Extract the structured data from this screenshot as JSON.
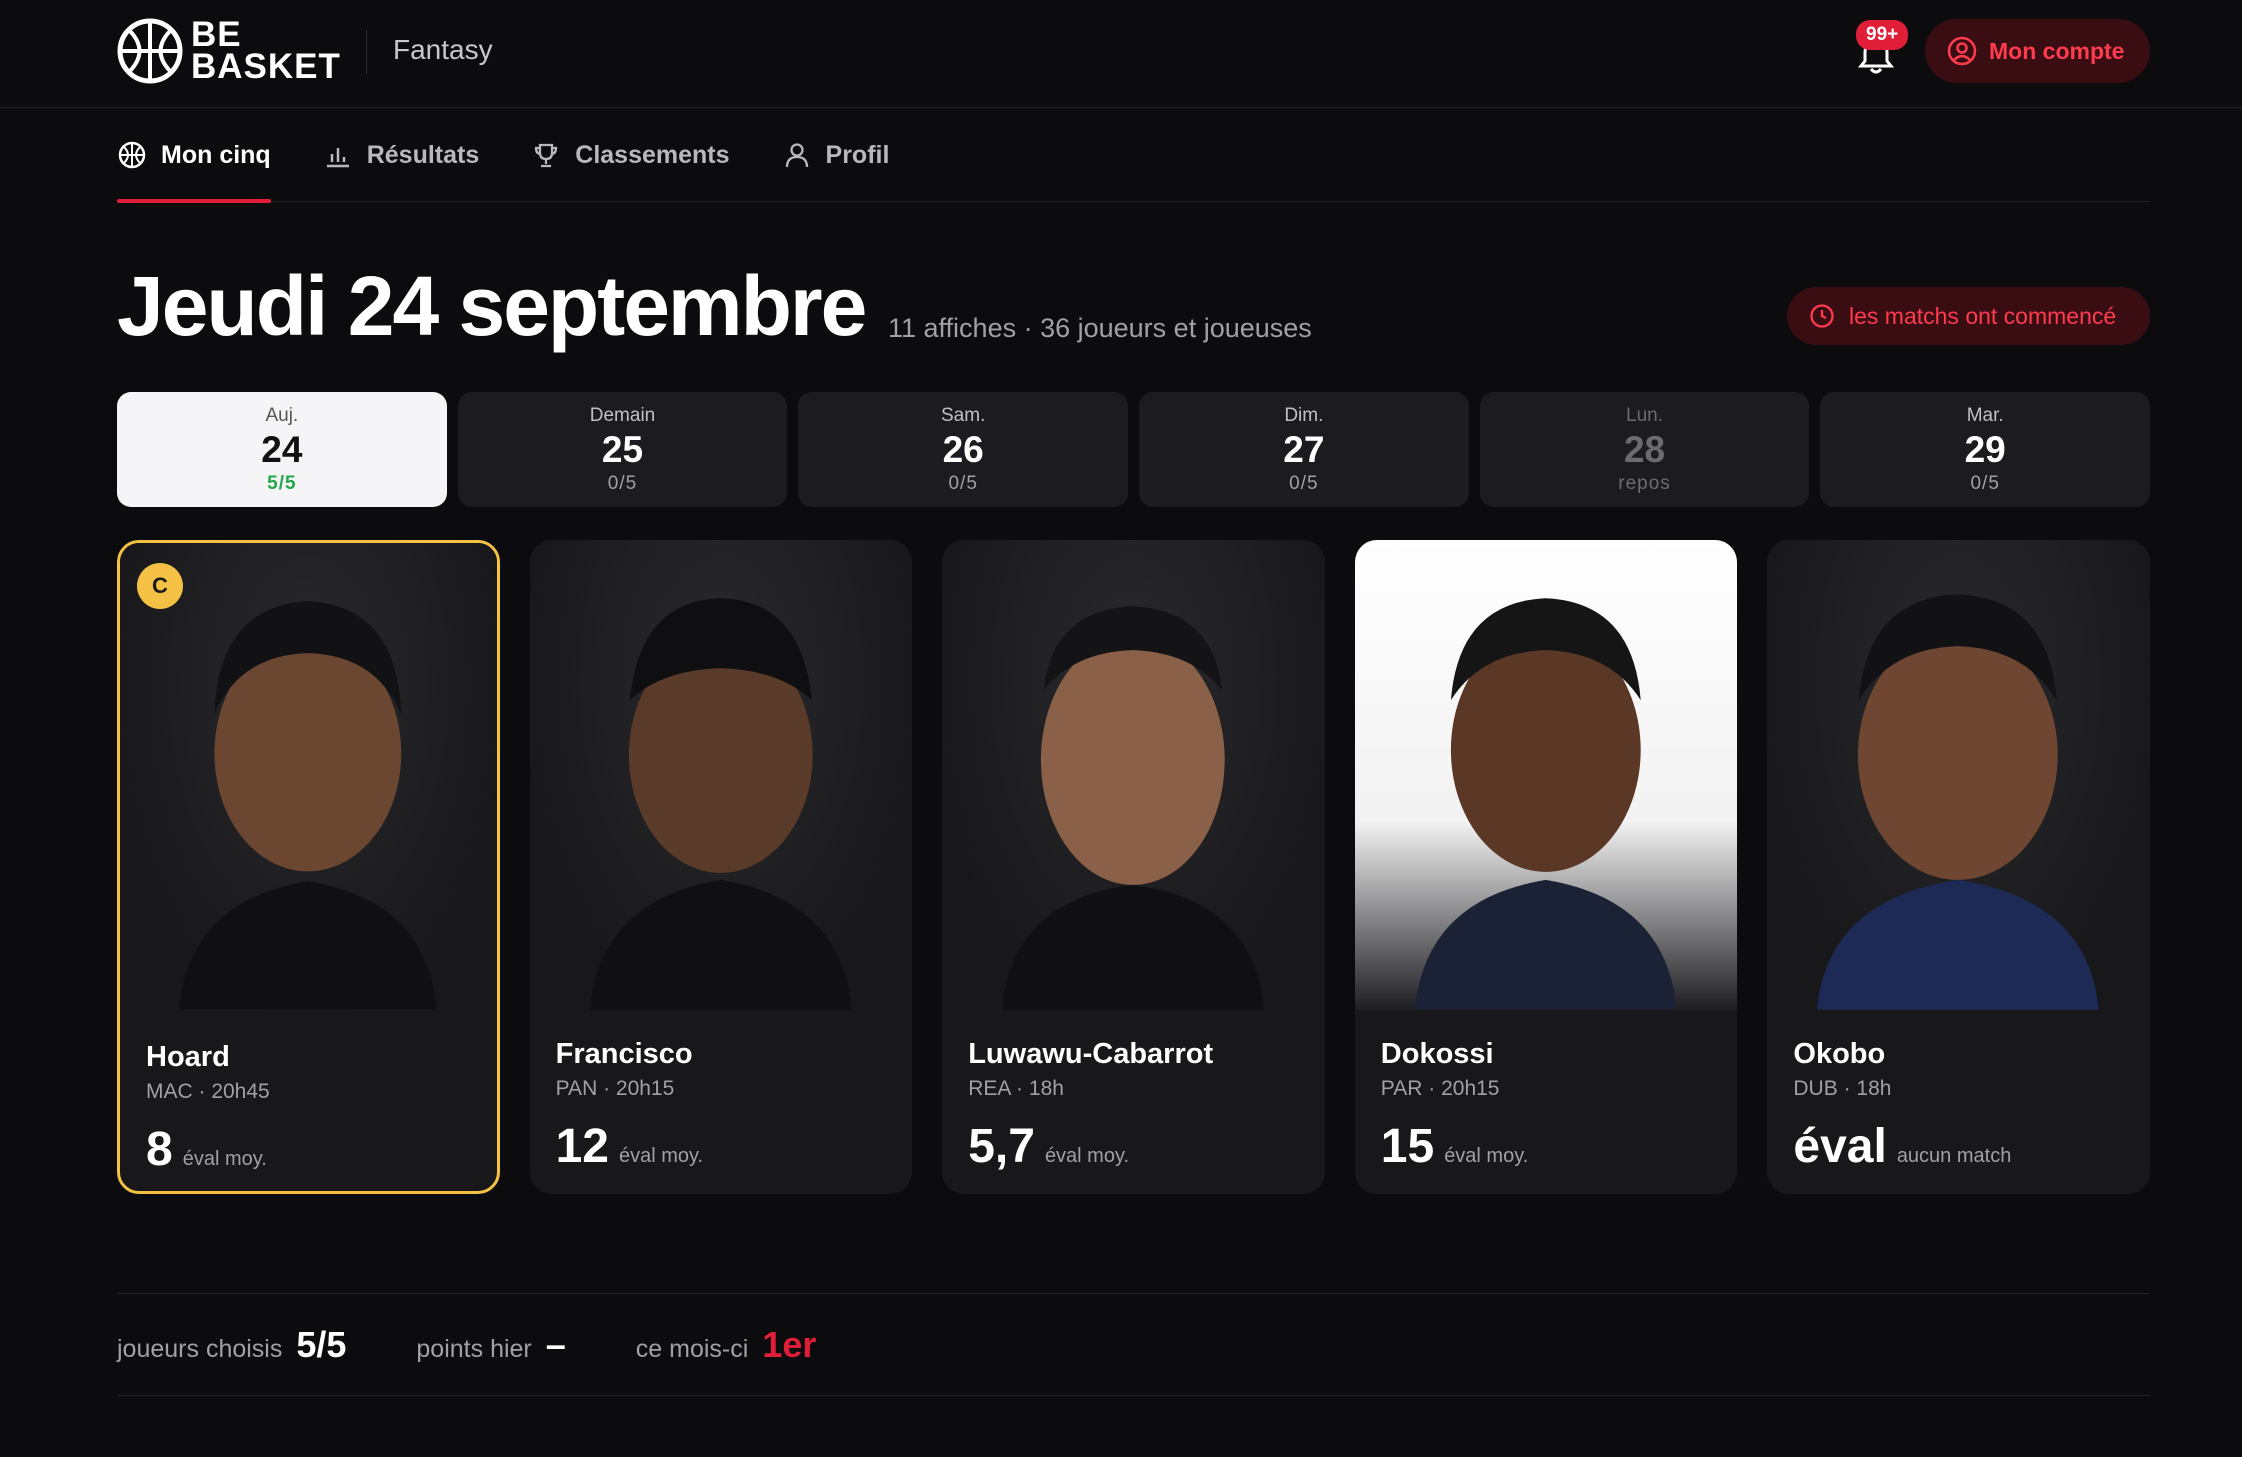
{
  "brand": {
    "line1": "BE",
    "line2": "BASKET",
    "product": "Fantasy"
  },
  "header": {
    "notifications": "99+",
    "account_label": "Mon compte"
  },
  "nav": [
    {
      "label": "Mon cinq",
      "icon": "basketball-icon",
      "active": true
    },
    {
      "label": "Résultats",
      "icon": "bar-chart-icon",
      "active": false
    },
    {
      "label": "Classements",
      "icon": "trophy-icon",
      "active": false
    },
    {
      "label": "Profil",
      "icon": "user-icon",
      "active": false
    }
  ],
  "page": {
    "title": "Jeudi 24 septembre",
    "subtitle": "11 affiches · 36 joueurs et joueuses",
    "status": "les matchs ont commencé"
  },
  "days": [
    {
      "name": "Auj.",
      "num": "24",
      "count": "5/5",
      "state": "active"
    },
    {
      "name": "Demain",
      "num": "25",
      "count": "0/5",
      "state": ""
    },
    {
      "name": "Sam.",
      "num": "26",
      "count": "0/5",
      "state": ""
    },
    {
      "name": "Dim.",
      "num": "27",
      "count": "0/5",
      "state": ""
    },
    {
      "name": "Lun.",
      "num": "28",
      "count": "repos",
      "state": "rest"
    },
    {
      "name": "Mar.",
      "num": "29",
      "count": "0/5",
      "state": ""
    }
  ],
  "players": [
    {
      "name": "Hoard",
      "meta": "MAC · 20h45",
      "score": "8",
      "score_label": "éval moy.",
      "captain": true,
      "captain_label": "C",
      "light_photo": false
    },
    {
      "name": "Francisco",
      "meta": "PAN · 20h15",
      "score": "12",
      "score_label": "éval moy.",
      "captain": false,
      "light_photo": false
    },
    {
      "name": "Luwawu-Cabarrot",
      "meta": "REA · 18h",
      "score": "5,7",
      "score_label": "éval moy.",
      "captain": false,
      "light_photo": false
    },
    {
      "name": "Dokossi",
      "meta": "PAR · 20h15",
      "score": "15",
      "score_label": "éval moy.",
      "captain": false,
      "light_photo": true
    },
    {
      "name": "Okobo",
      "meta": "DUB · 18h",
      "score": "éval",
      "score_label": "aucun match",
      "captain": false,
      "light_photo": false
    }
  ],
  "stats": {
    "chosen_label": "joueurs choisis",
    "chosen_value": "5/5",
    "yesterday_label": "points hier",
    "yesterday_value": "–",
    "month_label": "ce mois-ci",
    "month_value": "1er"
  },
  "colors": {
    "accent": "#e01e37",
    "captain": "#f5c145",
    "success": "#22a849"
  }
}
